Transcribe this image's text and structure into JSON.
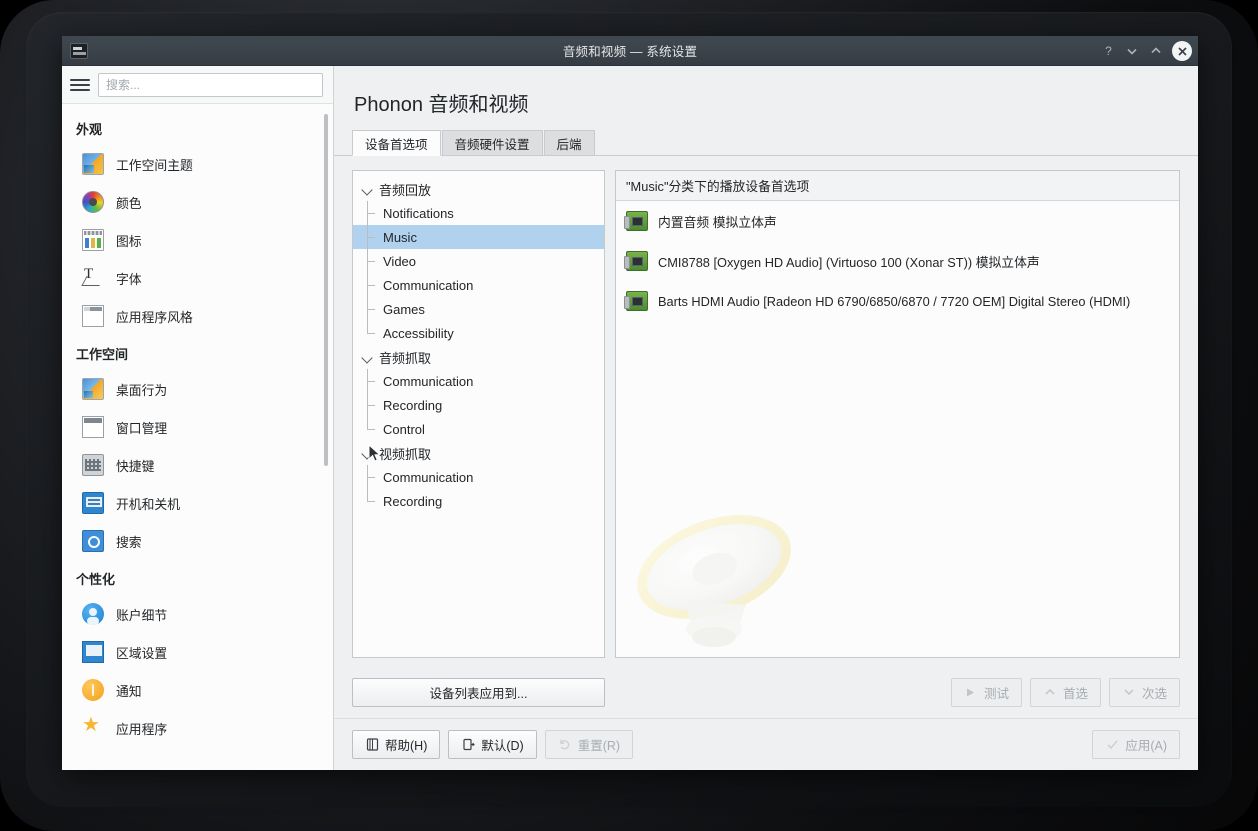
{
  "window": {
    "title": "音频和视频 — 系统设置",
    "app_icon": "settings-icon",
    "controls": {
      "help": "?",
      "minimize": "chevron-down-icon",
      "maximize": "chevron-up-icon",
      "close": "close-icon"
    }
  },
  "sidebar": {
    "menu_icon": "hamburger-icon",
    "search": {
      "placeholder": "搜索...",
      "value": ""
    },
    "groups": [
      {
        "title": "外观",
        "items": [
          {
            "label": "工作空间主题",
            "icon": "workspace-theme-icon"
          },
          {
            "label": "颜色",
            "icon": "colors-icon"
          },
          {
            "label": "图标",
            "icon": "icons-icon"
          },
          {
            "label": "字体",
            "icon": "fonts-icon"
          },
          {
            "label": "应用程序风格",
            "icon": "application-style-icon"
          }
        ]
      },
      {
        "title": "工作空间",
        "items": [
          {
            "label": "桌面行为",
            "icon": "desktop-behavior-icon"
          },
          {
            "label": "窗口管理",
            "icon": "window-management-icon"
          },
          {
            "label": "快捷键",
            "icon": "shortcuts-icon"
          },
          {
            "label": "开机和关机",
            "icon": "startup-shutdown-icon"
          },
          {
            "label": "搜索",
            "icon": "search-module-icon"
          }
        ]
      },
      {
        "title": "个性化",
        "items": [
          {
            "label": "账户细节",
            "icon": "account-details-icon"
          },
          {
            "label": "区域设置",
            "icon": "regional-settings-icon"
          },
          {
            "label": "通知",
            "icon": "notifications-icon"
          },
          {
            "label": "应用程序",
            "icon": "applications-icon"
          }
        ]
      }
    ]
  },
  "main": {
    "page_title": "Phonon 音频和视频",
    "tabs": [
      {
        "label": "设备首选项",
        "active": true
      },
      {
        "label": "音频硬件设置",
        "active": false
      },
      {
        "label": "后端",
        "active": false
      }
    ],
    "tree": [
      {
        "label": "音频回放",
        "expanded": true,
        "children": [
          {
            "label": "Notifications",
            "selected": false
          },
          {
            "label": "Music",
            "selected": true
          },
          {
            "label": "Video",
            "selected": false
          },
          {
            "label": "Communication",
            "selected": false
          },
          {
            "label": "Games",
            "selected": false
          },
          {
            "label": "Accessibility",
            "selected": false
          }
        ]
      },
      {
        "label": "音频抓取",
        "expanded": true,
        "children": [
          {
            "label": "Communication",
            "selected": false
          },
          {
            "label": "Recording",
            "selected": false
          },
          {
            "label": "Control",
            "selected": false
          }
        ]
      },
      {
        "label": "视频抓取",
        "expanded": true,
        "children": [
          {
            "label": "Communication",
            "selected": false
          },
          {
            "label": "Recording",
            "selected": false
          }
        ]
      }
    ],
    "device_panel": {
      "header": "\"Music\"分类下的播放设备首选项",
      "devices": [
        {
          "label": "内置音频 模拟立体声",
          "icon": "sound-card-icon"
        },
        {
          "label": "CMI8788 [Oxygen HD Audio] (Virtuoso 100 (Xonar ST)) 模拟立体声",
          "icon": "sound-card-icon"
        },
        {
          "label": "Barts HDMI Audio [Radeon HD 6790/6850/6870 / 7720 OEM] Digital Stereo (HDMI)",
          "icon": "sound-card-icon"
        }
      ],
      "watermark": "speaker-watermark"
    },
    "actions": {
      "apply_device_list": "设备列表应用到...",
      "test": "测试",
      "prefer": "首选",
      "defer": "次选"
    }
  },
  "bottom_bar": {
    "help": "帮助(H)",
    "defaults": "默认(D)",
    "reset": "重置(R)",
    "apply": "应用(A)"
  },
  "colors": {
    "titlebar": "#3b434b",
    "selection": "#b0d2ef",
    "window_bg": "#eff0f1",
    "pane_bg": "#fcfcfc"
  }
}
